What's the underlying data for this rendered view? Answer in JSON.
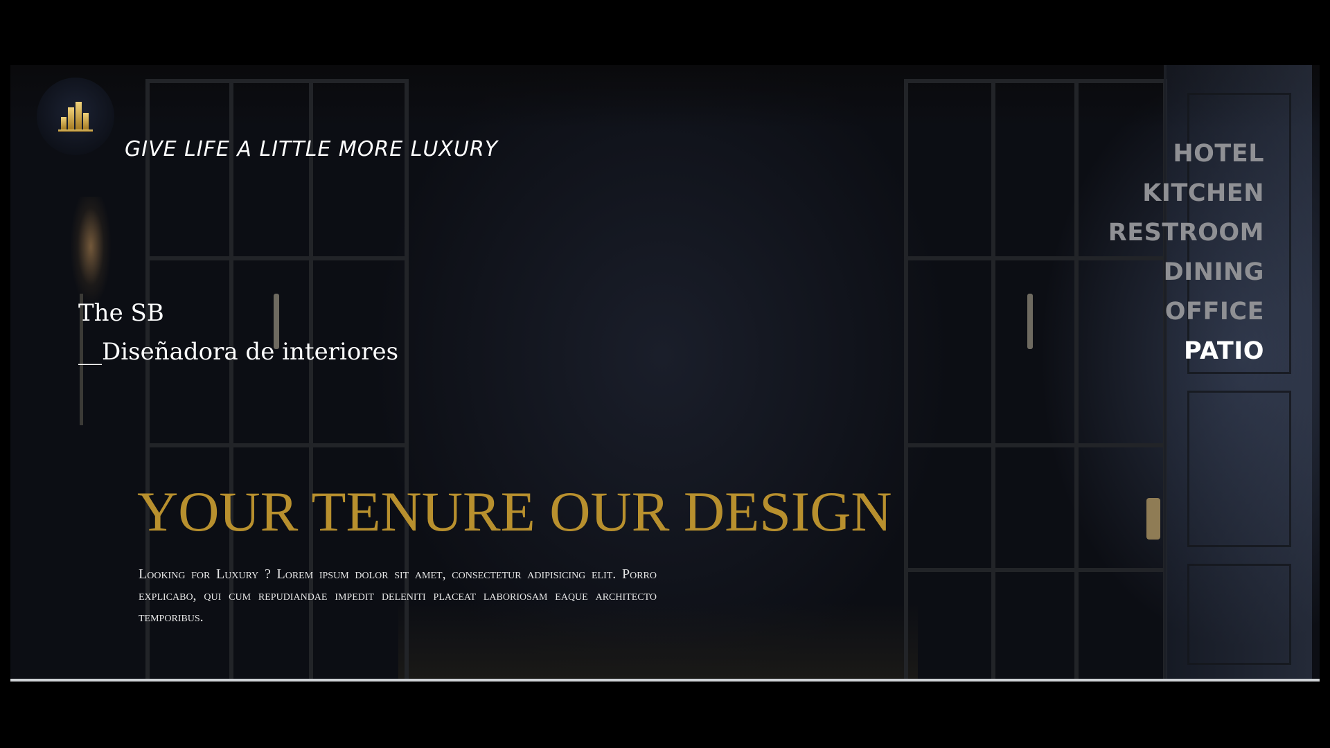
{
  "brand": {
    "logo_icon": "golden-buildings-icon",
    "tagline": "GIVE LIFE A LITTLE MORE LUXURY",
    "name": "The SB",
    "subtitle": "__Diseñadora de interiores"
  },
  "nav": {
    "items": [
      {
        "label": "HOTEL",
        "active": false
      },
      {
        "label": "KITCHEN",
        "active": false
      },
      {
        "label": "RESTROOM",
        "active": false
      },
      {
        "label": "DINING",
        "active": false
      },
      {
        "label": "OFFICE",
        "active": false
      },
      {
        "label": "PATIO",
        "active": true
      }
    ]
  },
  "hero": {
    "headline": "YOUR TENURE OUR DESIGN",
    "body": "Looking for Luxury ? Lorem ipsum dolor sit amet, consectetur adipisicing elit. Porro explicabo, qui cum repudiandae impedit deleniti placeat laboriosam eaque architecto temporibus."
  },
  "colors": {
    "accent_gold": "#b8902e",
    "nav_inactive": "#8f9094",
    "nav_active": "#ffffff",
    "background": "#000000"
  }
}
